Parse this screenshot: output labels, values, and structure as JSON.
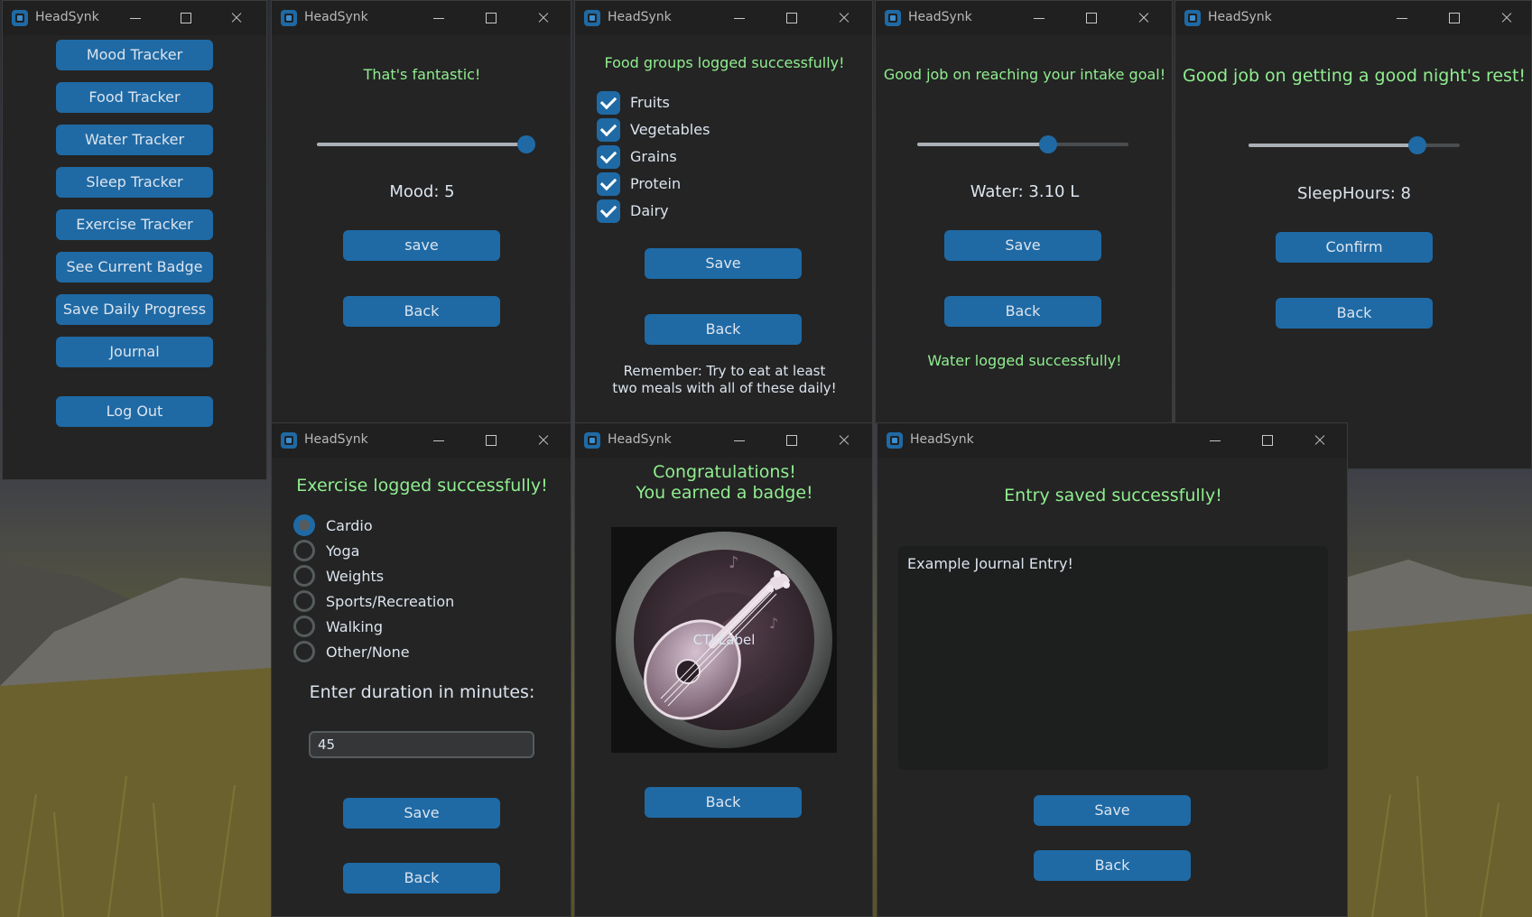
{
  "app_title": "HeadSynk",
  "menu": {
    "buttons": [
      "Mood Tracker",
      "Food Tracker",
      "Water Tracker",
      "Sleep Tracker",
      "Exercise Tracker",
      "See Current Badge",
      "Save Daily Progress",
      "Journal"
    ],
    "logout": "Log Out"
  },
  "mood": {
    "message": "That's fantastic!",
    "slider_value": 1.0,
    "value_label": "Mood: 5",
    "save": "save",
    "back": "Back"
  },
  "food": {
    "message": "Food groups logged successfully!",
    "groups": [
      "Fruits",
      "Vegetables",
      "Grains",
      "Protein",
      "Dairy"
    ],
    "checked": [
      true,
      true,
      true,
      true,
      true
    ],
    "save": "Save",
    "back": "Back",
    "reminder": "Remember: Try to eat at least two meals with all of these daily!"
  },
  "water": {
    "message": "Good job on reaching your intake goal!",
    "slider_value": 0.62,
    "value_label": "Water: 3.10 L",
    "save": "Save",
    "back": "Back",
    "status": "Water logged successfully!"
  },
  "sleep": {
    "message": "Good job on getting a good night's rest!",
    "slider_value": 0.8,
    "value_label": "SleepHours: 8",
    "confirm": "Confirm",
    "back": "Back"
  },
  "exercise": {
    "message": "Exercise logged successfully!",
    "options": [
      "Cardio",
      "Yoga",
      "Weights",
      "Sports/Recreation",
      "Walking",
      "Other/None"
    ],
    "selected": "Cardio",
    "duration_label": "Enter duration in minutes:",
    "duration_value": "45",
    "save": "Save",
    "back": "Back"
  },
  "badge": {
    "message_line1": "Congratulations!",
    "message_line2": "You earned a badge!",
    "image_caption": "CTkLabel",
    "badge_icon": "lute-badge-icon",
    "back": "Back"
  },
  "journal": {
    "message": "Entry saved successfully!",
    "entry_text": "Example Journal Entry!",
    "save": "Save",
    "back": "Back"
  },
  "colors": {
    "accent": "#1f6aa5",
    "success_text": "#90ee90",
    "window_bg": "#242424"
  }
}
